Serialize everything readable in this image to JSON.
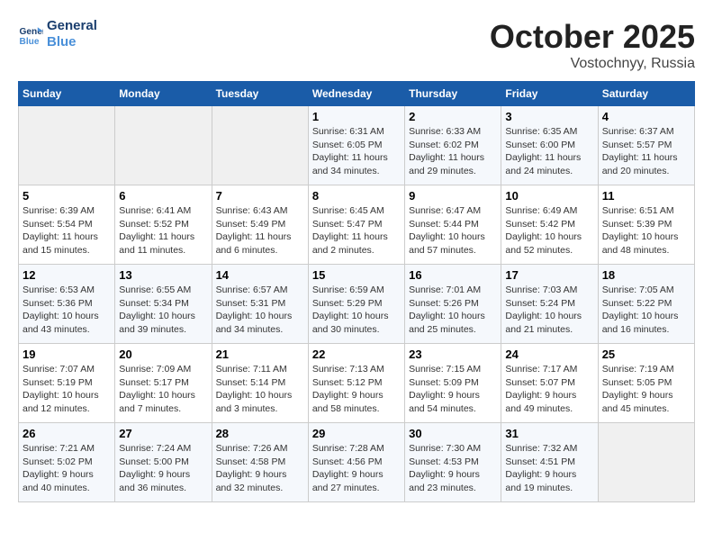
{
  "header": {
    "logo_line1": "General",
    "logo_line2": "Blue",
    "month": "October 2025",
    "location": "Vostochnyy, Russia"
  },
  "days_of_week": [
    "Sunday",
    "Monday",
    "Tuesday",
    "Wednesday",
    "Thursday",
    "Friday",
    "Saturday"
  ],
  "weeks": [
    [
      {
        "day": "",
        "info": ""
      },
      {
        "day": "",
        "info": ""
      },
      {
        "day": "",
        "info": ""
      },
      {
        "day": "1",
        "info": "Sunrise: 6:31 AM\nSunset: 6:05 PM\nDaylight: 11 hours and 34 minutes."
      },
      {
        "day": "2",
        "info": "Sunrise: 6:33 AM\nSunset: 6:02 PM\nDaylight: 11 hours and 29 minutes."
      },
      {
        "day": "3",
        "info": "Sunrise: 6:35 AM\nSunset: 6:00 PM\nDaylight: 11 hours and 24 minutes."
      },
      {
        "day": "4",
        "info": "Sunrise: 6:37 AM\nSunset: 5:57 PM\nDaylight: 11 hours and 20 minutes."
      }
    ],
    [
      {
        "day": "5",
        "info": "Sunrise: 6:39 AM\nSunset: 5:54 PM\nDaylight: 11 hours and 15 minutes."
      },
      {
        "day": "6",
        "info": "Sunrise: 6:41 AM\nSunset: 5:52 PM\nDaylight: 11 hours and 11 minutes."
      },
      {
        "day": "7",
        "info": "Sunrise: 6:43 AM\nSunset: 5:49 PM\nDaylight: 11 hours and 6 minutes."
      },
      {
        "day": "8",
        "info": "Sunrise: 6:45 AM\nSunset: 5:47 PM\nDaylight: 11 hours and 2 minutes."
      },
      {
        "day": "9",
        "info": "Sunrise: 6:47 AM\nSunset: 5:44 PM\nDaylight: 10 hours and 57 minutes."
      },
      {
        "day": "10",
        "info": "Sunrise: 6:49 AM\nSunset: 5:42 PM\nDaylight: 10 hours and 52 minutes."
      },
      {
        "day": "11",
        "info": "Sunrise: 6:51 AM\nSunset: 5:39 PM\nDaylight: 10 hours and 48 minutes."
      }
    ],
    [
      {
        "day": "12",
        "info": "Sunrise: 6:53 AM\nSunset: 5:36 PM\nDaylight: 10 hours and 43 minutes."
      },
      {
        "day": "13",
        "info": "Sunrise: 6:55 AM\nSunset: 5:34 PM\nDaylight: 10 hours and 39 minutes."
      },
      {
        "day": "14",
        "info": "Sunrise: 6:57 AM\nSunset: 5:31 PM\nDaylight: 10 hours and 34 minutes."
      },
      {
        "day": "15",
        "info": "Sunrise: 6:59 AM\nSunset: 5:29 PM\nDaylight: 10 hours and 30 minutes."
      },
      {
        "day": "16",
        "info": "Sunrise: 7:01 AM\nSunset: 5:26 PM\nDaylight: 10 hours and 25 minutes."
      },
      {
        "day": "17",
        "info": "Sunrise: 7:03 AM\nSunset: 5:24 PM\nDaylight: 10 hours and 21 minutes."
      },
      {
        "day": "18",
        "info": "Sunrise: 7:05 AM\nSunset: 5:22 PM\nDaylight: 10 hours and 16 minutes."
      }
    ],
    [
      {
        "day": "19",
        "info": "Sunrise: 7:07 AM\nSunset: 5:19 PM\nDaylight: 10 hours and 12 minutes."
      },
      {
        "day": "20",
        "info": "Sunrise: 7:09 AM\nSunset: 5:17 PM\nDaylight: 10 hours and 7 minutes."
      },
      {
        "day": "21",
        "info": "Sunrise: 7:11 AM\nSunset: 5:14 PM\nDaylight: 10 hours and 3 minutes."
      },
      {
        "day": "22",
        "info": "Sunrise: 7:13 AM\nSunset: 5:12 PM\nDaylight: 9 hours and 58 minutes."
      },
      {
        "day": "23",
        "info": "Sunrise: 7:15 AM\nSunset: 5:09 PM\nDaylight: 9 hours and 54 minutes."
      },
      {
        "day": "24",
        "info": "Sunrise: 7:17 AM\nSunset: 5:07 PM\nDaylight: 9 hours and 49 minutes."
      },
      {
        "day": "25",
        "info": "Sunrise: 7:19 AM\nSunset: 5:05 PM\nDaylight: 9 hours and 45 minutes."
      }
    ],
    [
      {
        "day": "26",
        "info": "Sunrise: 7:21 AM\nSunset: 5:02 PM\nDaylight: 9 hours and 40 minutes."
      },
      {
        "day": "27",
        "info": "Sunrise: 7:24 AM\nSunset: 5:00 PM\nDaylight: 9 hours and 36 minutes."
      },
      {
        "day": "28",
        "info": "Sunrise: 7:26 AM\nSunset: 4:58 PM\nDaylight: 9 hours and 32 minutes."
      },
      {
        "day": "29",
        "info": "Sunrise: 7:28 AM\nSunset: 4:56 PM\nDaylight: 9 hours and 27 minutes."
      },
      {
        "day": "30",
        "info": "Sunrise: 7:30 AM\nSunset: 4:53 PM\nDaylight: 9 hours and 23 minutes."
      },
      {
        "day": "31",
        "info": "Sunrise: 7:32 AM\nSunset: 4:51 PM\nDaylight: 9 hours and 19 minutes."
      },
      {
        "day": "",
        "info": ""
      }
    ]
  ]
}
